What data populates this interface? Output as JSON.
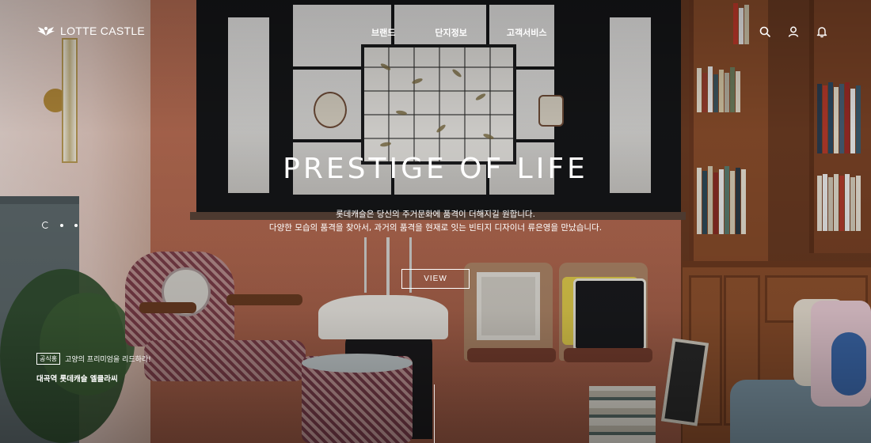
{
  "brand": {
    "name": "LOTTE CASTLE",
    "logo_icon": "wings-crest-icon"
  },
  "nav": {
    "items": [
      {
        "label": "브랜드"
      },
      {
        "label": "단지정보"
      },
      {
        "label": "고객서비스"
      }
    ]
  },
  "utility": {
    "search_icon": "search-icon",
    "user_icon": "user-icon",
    "bell_icon": "bell-icon"
  },
  "hero": {
    "title": "PRESTIGE OF LIFE",
    "desc_line1": "롯데캐슬은 당신의 주거문화에 품격이 더해지길 원합니다.",
    "desc_line2": "다양한 모습의 품격을 찾아서, 과거의 품격을 현재로 잇는 빈티지 디자이너 류은영을 만났습니다.",
    "button_label": "VIEW"
  },
  "pager": {
    "total": 3,
    "active": 1
  },
  "promo": {
    "badge": "공식홍",
    "subtitle": "고양의 프리미엄을 리드하라!",
    "title": "대곡역 롯데캐슬 엘클라씨"
  },
  "colors": {
    "text": "#ffffff",
    "accent_wall": "#b96f55"
  }
}
